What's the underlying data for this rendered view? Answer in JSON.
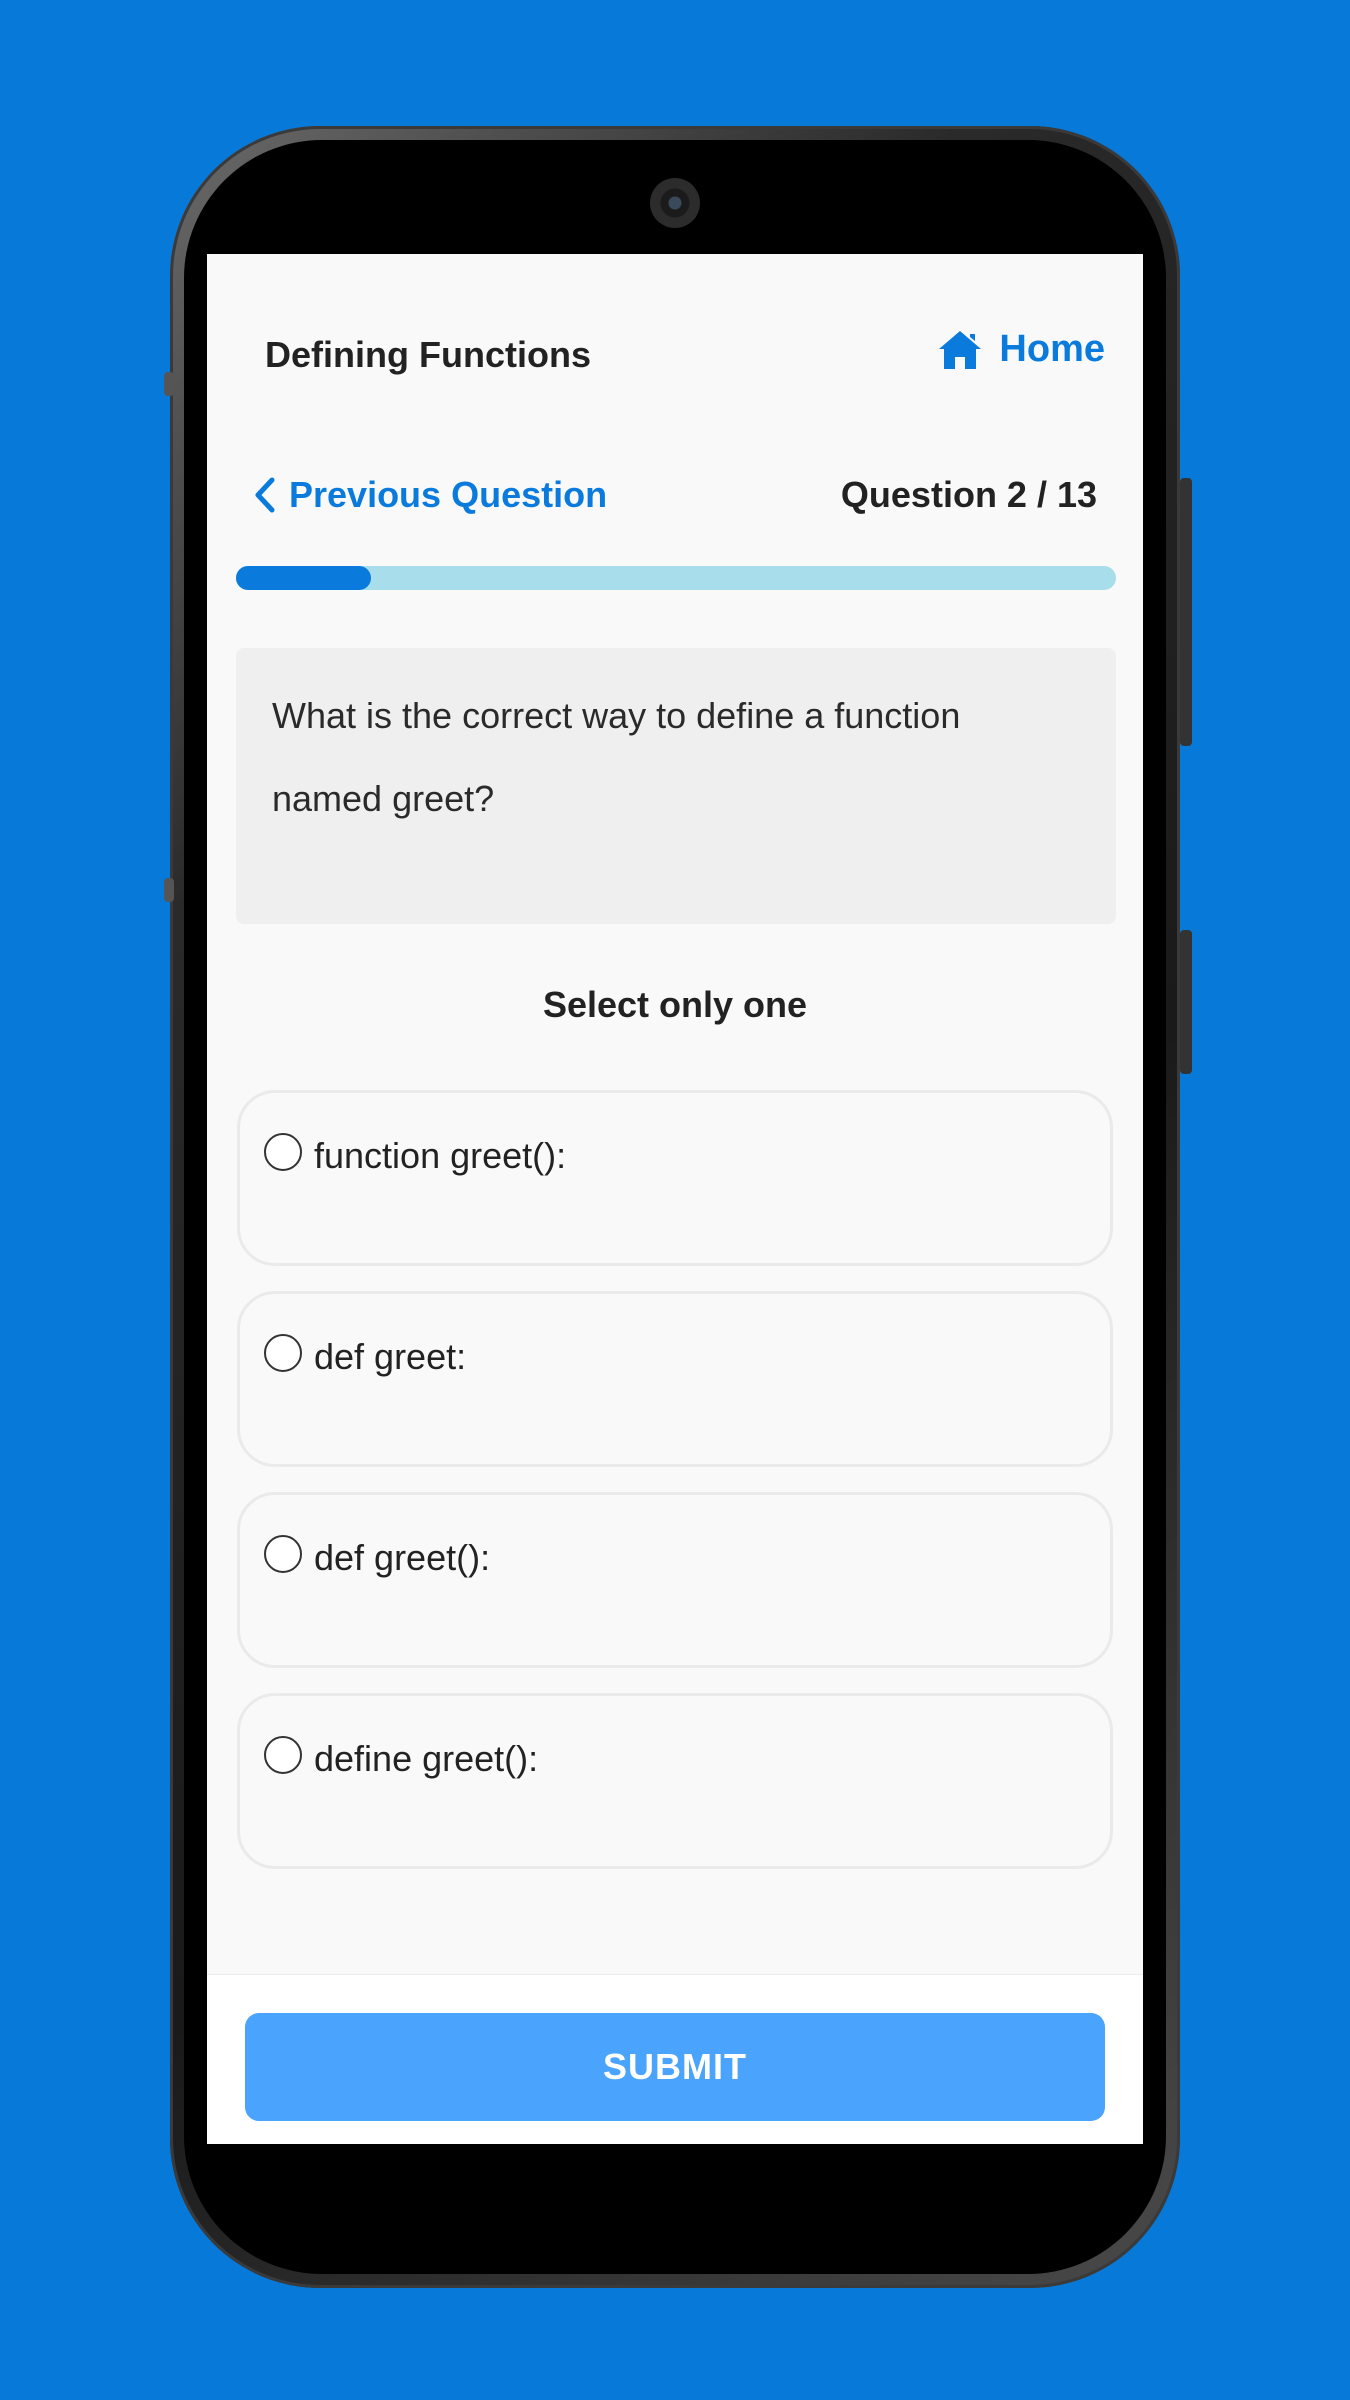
{
  "header": {
    "topic_title": "Defining Functions",
    "home_label": "Home"
  },
  "nav": {
    "previous_label": "Previous Question",
    "question_counter": "Question 2 / 13"
  },
  "progress": {
    "current": 2,
    "total": 13
  },
  "question": {
    "line1": "What is the correct way to define a function",
    "line2": "named greet?"
  },
  "instruction": "Select only one",
  "options": [
    {
      "label": "function greet():"
    },
    {
      "label": "def greet:"
    },
    {
      "label": "def greet():"
    },
    {
      "label": "define greet():"
    }
  ],
  "footer": {
    "submit_label": "SUBMIT"
  },
  "colors": {
    "background": "#0679D9",
    "accent": "#0A7BDC",
    "progress_track": "#A8DDEB",
    "submit_button": "#4AA3FC"
  },
  "icons": {
    "home": "home-icon",
    "back": "chevron-left-icon"
  }
}
